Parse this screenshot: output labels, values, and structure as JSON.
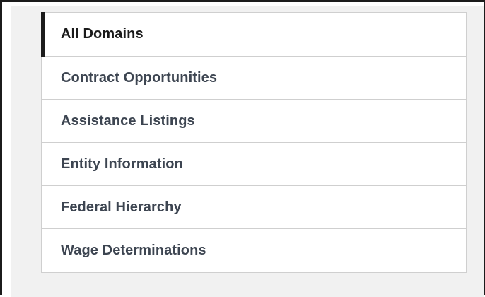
{
  "domains": {
    "items": [
      {
        "label": "All Domains",
        "selected": true
      },
      {
        "label": "Contract Opportunities",
        "selected": false
      },
      {
        "label": "Assistance Listings",
        "selected": false
      },
      {
        "label": "Entity Information",
        "selected": false
      },
      {
        "label": "Federal Hierarchy",
        "selected": false
      },
      {
        "label": "Wage Determinations",
        "selected": false
      }
    ]
  },
  "colors": {
    "active_indicator": "#1b1b1b",
    "label_text": "#3d4551",
    "panel_background": "#f1f1f1",
    "border": "#cfcfcf"
  }
}
